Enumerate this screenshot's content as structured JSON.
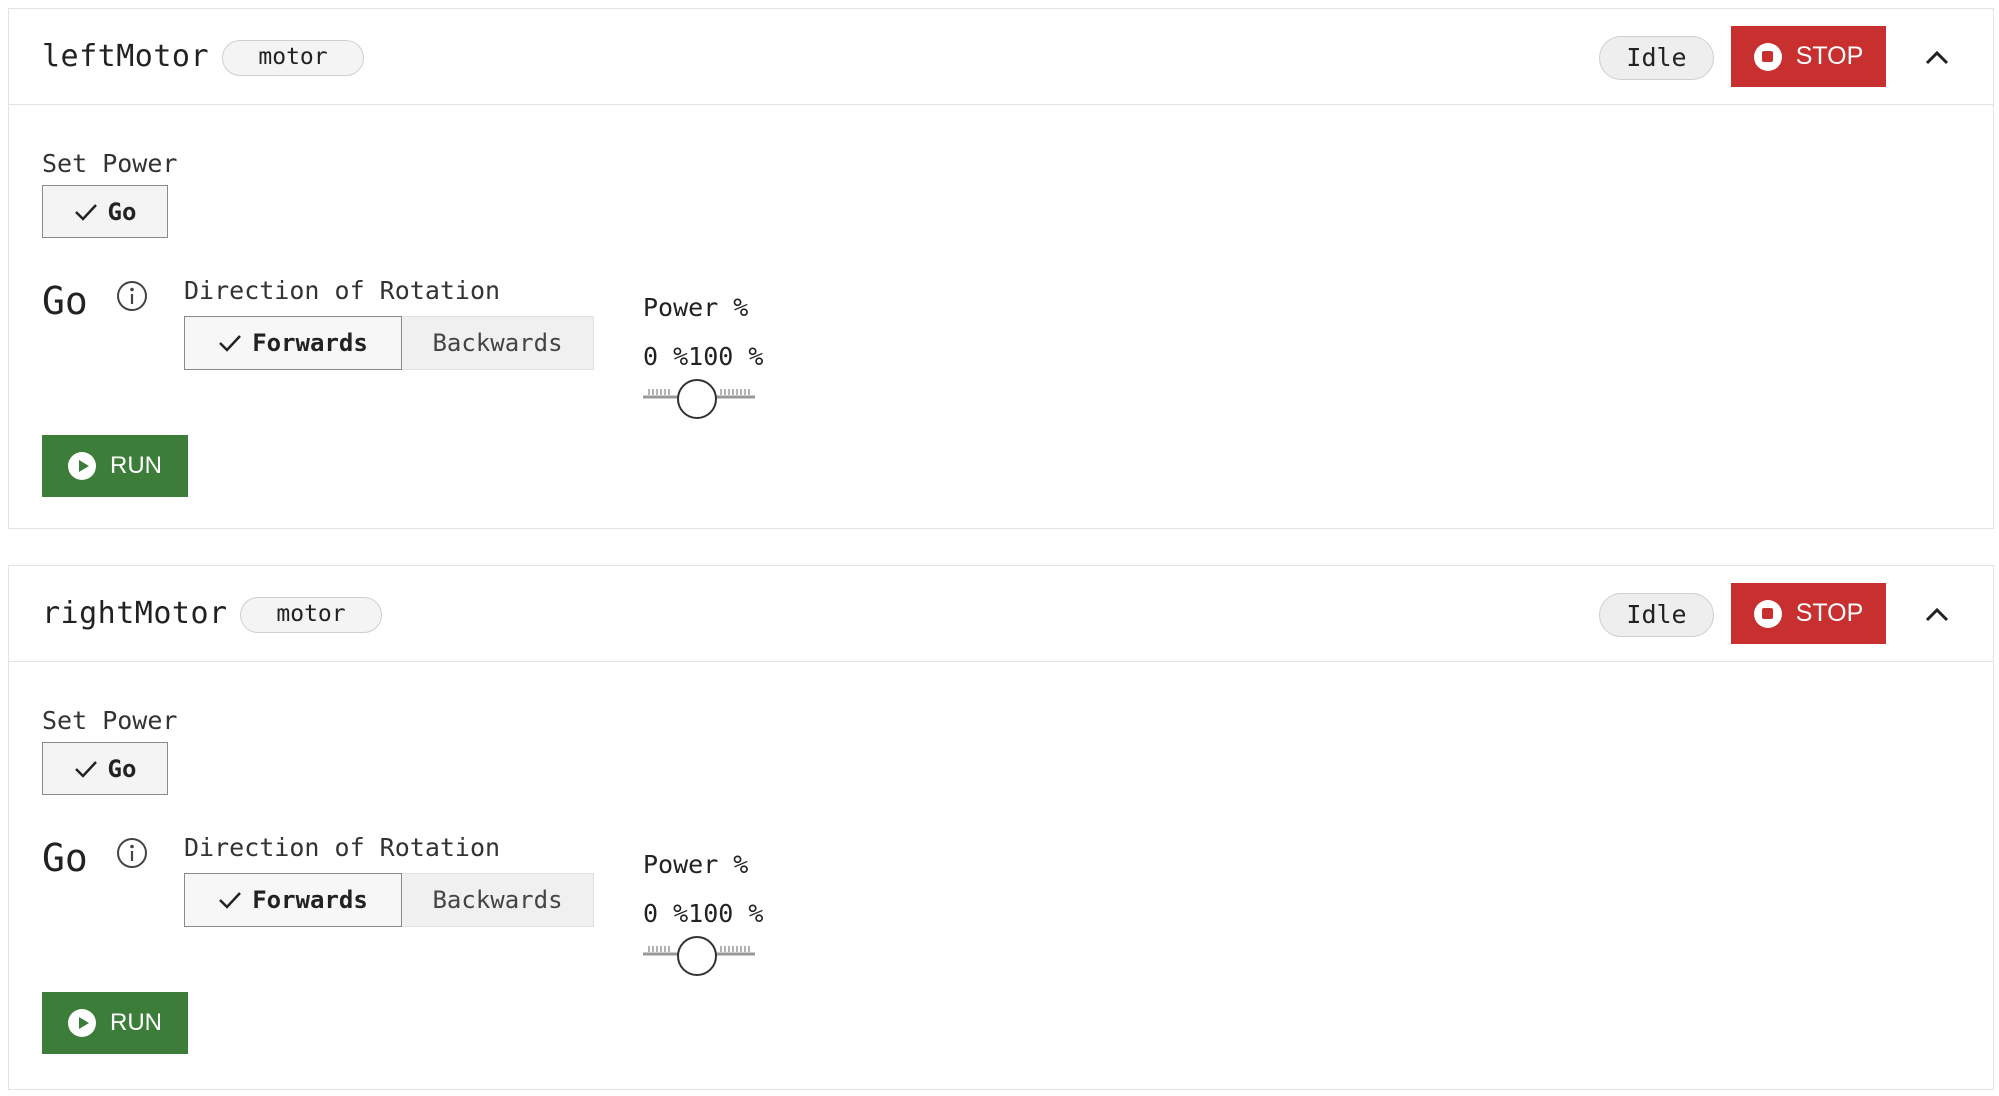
{
  "motors": [
    {
      "name": "leftMotor",
      "type_tag": "motor",
      "status": "Idle",
      "stop_label": "STOP",
      "set_power_label": "Set Power",
      "go_toggle_label": "Go",
      "go_heading": "Go",
      "direction_label": "Direction of Rotation",
      "direction_options": [
        "Forwards",
        "Backwards"
      ],
      "direction_selected": "Forwards",
      "power_label": "Power %",
      "power_range_text": "0 %100 %",
      "power_value_percent": 50,
      "run_label": "RUN"
    },
    {
      "name": "rightMotor",
      "type_tag": "motor",
      "status": "Idle",
      "stop_label": "STOP",
      "set_power_label": "Set Power",
      "go_toggle_label": "Go",
      "go_heading": "Go",
      "direction_label": "Direction of Rotation",
      "direction_options": [
        "Forwards",
        "Backwards"
      ],
      "direction_selected": "Forwards",
      "power_label": "Power %",
      "power_range_text": "0 %100 %",
      "power_value_percent": 50,
      "run_label": "RUN"
    }
  ],
  "colors": {
    "stop_red": "#c8302f",
    "run_green": "#3d7d3a",
    "border": "#e3e3e3"
  }
}
